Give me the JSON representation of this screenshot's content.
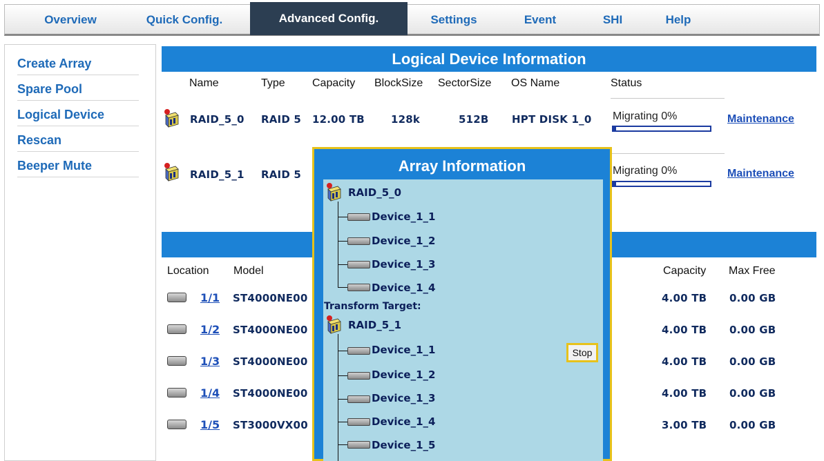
{
  "nav": {
    "tabs": [
      "Overview",
      "Quick Config.",
      "Advanced Config.",
      "Settings",
      "Event",
      "SHI",
      "Help"
    ],
    "active": "Advanced Config."
  },
  "sidebar": {
    "items": [
      "Create Array",
      "Spare Pool",
      "Logical Device",
      "Rescan",
      "Beeper Mute"
    ]
  },
  "logical": {
    "title": "Logical Device Information",
    "headers": {
      "name": "Name",
      "type": "Type",
      "capacity": "Capacity",
      "blocksize": "BlockSize",
      "sectorsize": "SectorSize",
      "osname": "OS Name",
      "status": "Status"
    },
    "rows": [
      {
        "name": "RAID_5_0",
        "type": "RAID 5",
        "capacity": "12.00 TB",
        "blocksize": "128k",
        "sectorsize": "512B",
        "osname": "HPT DISK 1_0",
        "status": "Migrating 0%",
        "progress": 0.03,
        "action": "Maintenance"
      },
      {
        "name": "RAID_5_1",
        "type": "RAID 5",
        "status": "Migrating 0%",
        "progress": 0.03,
        "action": "Maintenance"
      }
    ]
  },
  "physical": {
    "headers": {
      "location": "Location",
      "model": "Model",
      "capacity": "Capacity",
      "maxfree": "Max Free"
    },
    "rows": [
      {
        "location": "1/1",
        "model": "ST4000NE00",
        "capacity": "4.00 TB",
        "maxfree": "0.00 GB"
      },
      {
        "location": "1/2",
        "model": "ST4000NE00",
        "capacity": "4.00 TB",
        "maxfree": "0.00 GB"
      },
      {
        "location": "1/3",
        "model": "ST4000NE00",
        "capacity": "4.00 TB",
        "maxfree": "0.00 GB"
      },
      {
        "location": "1/4",
        "model": "ST4000NE00",
        "capacity": "4.00 TB",
        "maxfree": "0.00 GB"
      },
      {
        "location": "1/5",
        "model": "ST3000VX00",
        "capacity": "3.00 TB",
        "maxfree": "0.00 GB"
      }
    ]
  },
  "popup": {
    "title": "Array Information",
    "source": {
      "name": "RAID_5_0",
      "devices": [
        "Device_1_1",
        "Device_1_2",
        "Device_1_3",
        "Device_1_4"
      ]
    },
    "target_label": "Transform Target:",
    "target": {
      "name": "RAID_5_1",
      "devices": [
        "Device_1_1",
        "Device_1_2",
        "Device_1_3",
        "Device_1_4",
        "Device_1_5"
      ]
    },
    "stop_label": "Stop"
  },
  "colors": {
    "accent": "#1c82d6",
    "nav_active": "#2c3e52",
    "link": "#1d4fb8",
    "popup_border": "#e7c21b",
    "popup_body": "#add8e6"
  }
}
